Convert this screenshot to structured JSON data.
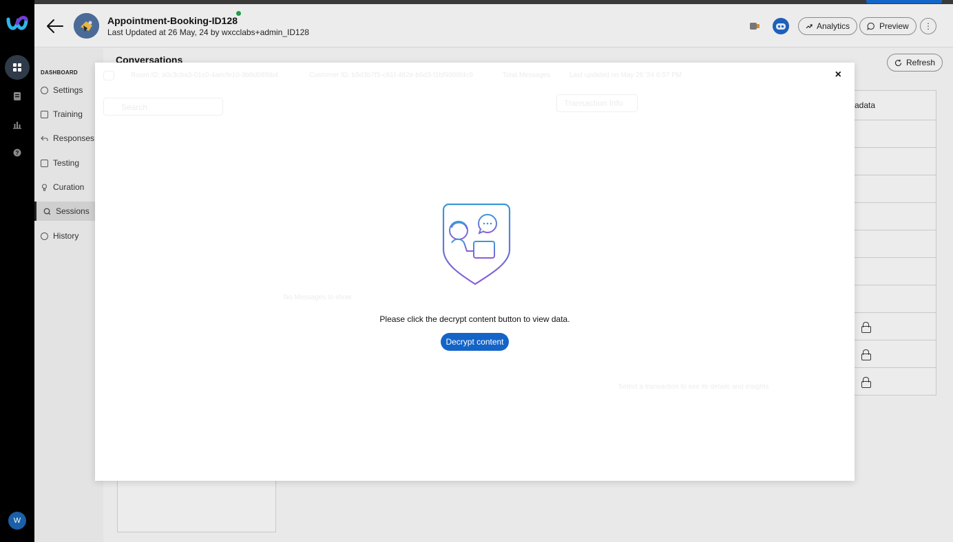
{
  "header": {
    "bot_title": "Appointment-Booking-ID128",
    "bot_subtitle": "Last Updated at 26 May, 24 by wxcclabs+admin_ID128",
    "analytics_label": "Analytics",
    "preview_label": "Preview",
    "more_glyph": "⋮"
  },
  "sidebar": {
    "section_label": "DASHBOARD",
    "items": [
      {
        "label": "Settings",
        "icon": "gear-icon"
      },
      {
        "label": "Training",
        "icon": "training-icon"
      },
      {
        "label": "Responses",
        "icon": "reply-icon"
      },
      {
        "label": "Testing",
        "icon": "testing-icon"
      },
      {
        "label": "Curation",
        "icon": "bulb-icon"
      },
      {
        "label": "Sessions",
        "icon": "chat-icon",
        "active": true
      },
      {
        "label": "History",
        "icon": "history-icon"
      }
    ]
  },
  "rail": {
    "user_initial": "W"
  },
  "page": {
    "title": "Conversations",
    "refresh_label": "Refresh",
    "table_header_partial": "adata"
  },
  "modal": {
    "close_glyph": "×",
    "prompt_text": "Please click the decrypt content button to view data.",
    "decrypt_label": "Decrypt content",
    "ghost_session_id": "Room ID: a0c3cba3-01c0-4aecfe10-9b8d08f6b4",
    "ghost_customer_id": "Customer ID: b5d3b7f5-c81f-482e-b6d3-f1bf9988f4c9",
    "ghost_total_messages": "Total Messages",
    "ghost_last_updated": "Last updated on May 26 '24 6:57 PM",
    "ghost_search": "Search",
    "ghost_transaction": "Transaction Info",
    "ghost_no_messages": "No Messages to show",
    "ghost_select_hint": "Select a transaction to see its details and insights"
  },
  "colors": {
    "accent": "#1464c8",
    "status_online": "#1e9e45",
    "rail_bg": "#000000"
  }
}
